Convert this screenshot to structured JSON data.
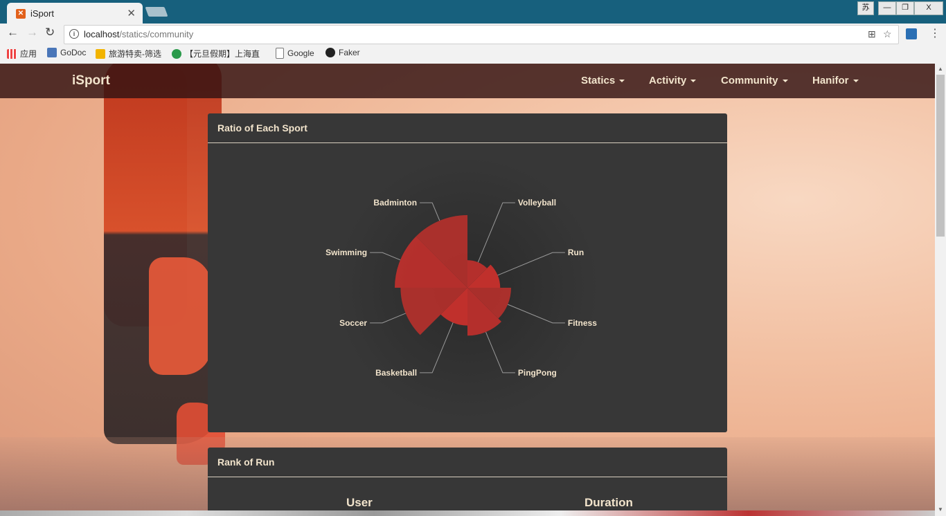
{
  "browser": {
    "tab_title": "iSport",
    "url_host": "localhost",
    "url_path": "/statics/community",
    "ime_label": "苏",
    "window_minimize": "—",
    "window_restore": "❐",
    "window_close": "X"
  },
  "bookmarks": [
    {
      "label": "应用",
      "icon": "apps-grid-icon"
    },
    {
      "label": "GoDoc",
      "icon": "godoc-icon"
    },
    {
      "label": "旅游特卖-筛选",
      "icon": "travel-icon"
    },
    {
      "label": "【元旦假期】上海直",
      "icon": "q-icon"
    },
    {
      "label": "Google",
      "icon": "page-icon"
    },
    {
      "label": "Faker",
      "icon": "github-icon"
    }
  ],
  "navbar": {
    "brand": "iSport",
    "items": [
      "Statics",
      "Activity",
      "Community",
      "Hanifor"
    ]
  },
  "panel_ratio": {
    "title": "Ratio of Each Sport"
  },
  "panel_rank": {
    "title": "Rank of Run",
    "columns": [
      "User",
      "Duration"
    ]
  },
  "colors": {
    "navbar_bg": "#3a1616",
    "panel_bg": "#373737",
    "text": "#f2e4cc",
    "slice": "#c0302c"
  },
  "chart_data": {
    "type": "pie",
    "variant": "rose",
    "title": "Ratio of Each Sport",
    "categories": [
      "Badminton",
      "Volleyball",
      "Run",
      "Fitness",
      "PingPong",
      "Basketball",
      "Soccer",
      "Swimming"
    ],
    "values": [
      100,
      38,
      45,
      60,
      66,
      52,
      92,
      100
    ]
  }
}
